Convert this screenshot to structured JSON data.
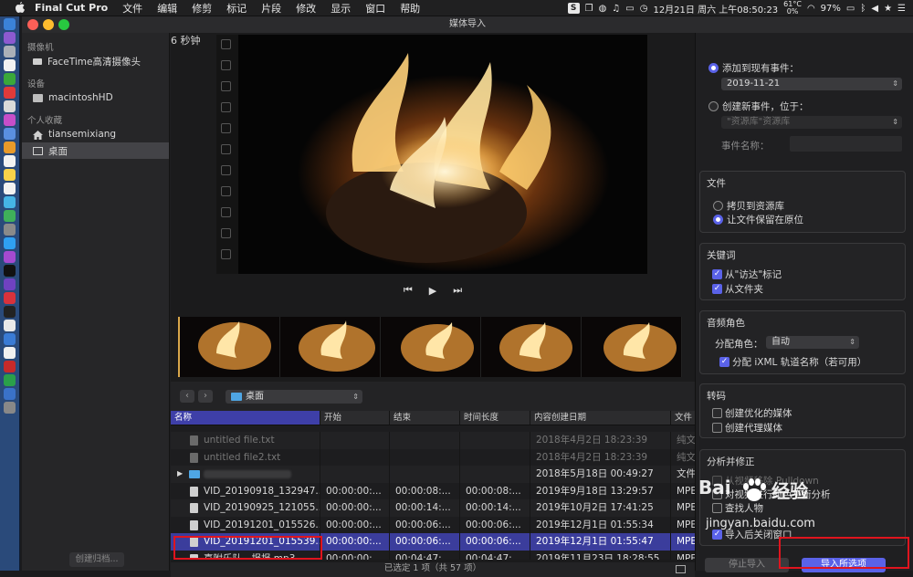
{
  "menubar": {
    "apple": "",
    "items": [
      "Final Cut Pro",
      "文件",
      "编辑",
      "修剪",
      "标记",
      "片段",
      "修改",
      "显示",
      "窗口",
      "帮助"
    ],
    "cpu_temp": "61°C",
    "cpu_pct": "0%",
    "battery": "97%",
    "datetime": "12月21日 周六 上午08:50:23"
  },
  "window": {
    "title": "媒体导入"
  },
  "sidebar": {
    "sections": [
      {
        "heading": "摄像机",
        "items": [
          {
            "label": "FaceTime高清摄像头",
            "icon": "camera-icon"
          }
        ]
      },
      {
        "heading": "设备",
        "items": [
          {
            "label": "macintoshHD",
            "icon": "disk-icon"
          }
        ]
      },
      {
        "heading": "个人收藏",
        "items": [
          {
            "label": "tiansemixiang",
            "icon": "home-icon"
          },
          {
            "label": "桌面",
            "icon": "desktop-icon",
            "selected": true
          }
        ]
      }
    ],
    "create_archive": "创建归档..."
  },
  "viewer": {
    "duration_label": "6 秒钟"
  },
  "browser": {
    "folder": "桌面",
    "columns": [
      "名称",
      "开始",
      "结束",
      "时间长度",
      "内容创建日期",
      "文件"
    ],
    "rows": [
      {
        "name": "untitled file.txt",
        "start": "",
        "end": "",
        "duration": "",
        "date": "2018年4月2日 18:23:39",
        "type": "纯文",
        "style": "dim",
        "icon": "file"
      },
      {
        "name": "untitled file2.txt",
        "start": "",
        "end": "",
        "duration": "",
        "date": "2018年4月2日 18:23:39",
        "type": "纯文",
        "style": "dim",
        "icon": "file"
      },
      {
        "name": "",
        "start": "",
        "end": "",
        "duration": "",
        "date": "2018年5月18日 00:49:27",
        "type": "文件",
        "style": "",
        "icon": "folder"
      },
      {
        "name": "VID_20190918_132947....",
        "start": "00:00:00:...",
        "end": "00:00:08:...",
        "duration": "00:00:08:...",
        "date": "2019年9月18日 13:29:57",
        "type": "MPE",
        "style": "",
        "icon": "video"
      },
      {
        "name": "VID_20190925_121055....",
        "start": "00:00:00:...",
        "end": "00:00:14:...",
        "duration": "00:00:14:...",
        "date": "2019年10月2日 17:41:25",
        "type": "MPE",
        "style": "",
        "icon": "video"
      },
      {
        "name": "VID_20191201_015526....",
        "start": "00:00:00:...",
        "end": "00:00:06:...",
        "duration": "00:00:06:...",
        "date": "2019年12月1日 01:55:34",
        "type": "MPE",
        "style": "",
        "icon": "video"
      },
      {
        "name": "VID_20191201_015539....",
        "start": "00:00:00:...",
        "end": "00:00:06:...",
        "duration": "00:00:06:...",
        "date": "2019年12月1日 01:55:47",
        "type": "MPE",
        "style": "sel",
        "icon": "video"
      },
      {
        "name": "喜附乐队 - 报报.mp3",
        "start": "00:00:00:...",
        "end": "00:04:47:...",
        "duration": "00:04:47:...",
        "date": "2019年11月23日 18:28:55",
        "type": "MPE",
        "style": "",
        "icon": "video"
      }
    ],
    "status": "已选定 1 项（共 57 项）"
  },
  "inspector": {
    "add_existing": "添加到现有事件：",
    "existing_event": "2019-11-21",
    "new_event": "创建新事件，位于：",
    "library": "\"资源库\"资源库",
    "event_name_label": "事件名称：",
    "files_title": "文件",
    "copy_library": "拷贝到资源库",
    "leave_in_place": "让文件保留在原位",
    "keywords_title": "关键词",
    "from_finder": "从\"访达\"标记",
    "from_folders": "从文件夹",
    "audio_title": "音频角色",
    "assign_role_label": "分配角色：",
    "assign_role_value": "自动",
    "assign_ixml": "分配 iXML 轨道名称（若可用）",
    "transcode_title": "转码",
    "optimized": "创建优化的媒体",
    "proxy": "创建代理媒体",
    "analyze_title": "分析并修正",
    "pulldown": "从视频移除 Pulldown",
    "balance": "对视频进行颜色平衡分析",
    "find_people": "查找人物",
    "after_import": "导入后关闭窗口",
    "stop_import": "停止导入",
    "import_selected": "导入所选项"
  },
  "watermark": {
    "brand": "Bai",
    "brand2": "经验",
    "url": "jingyan.baidu.com"
  },
  "colors": {
    "accent": "#5a62e8",
    "selection": "#3b3d9c",
    "highlight": "#e0141e"
  }
}
